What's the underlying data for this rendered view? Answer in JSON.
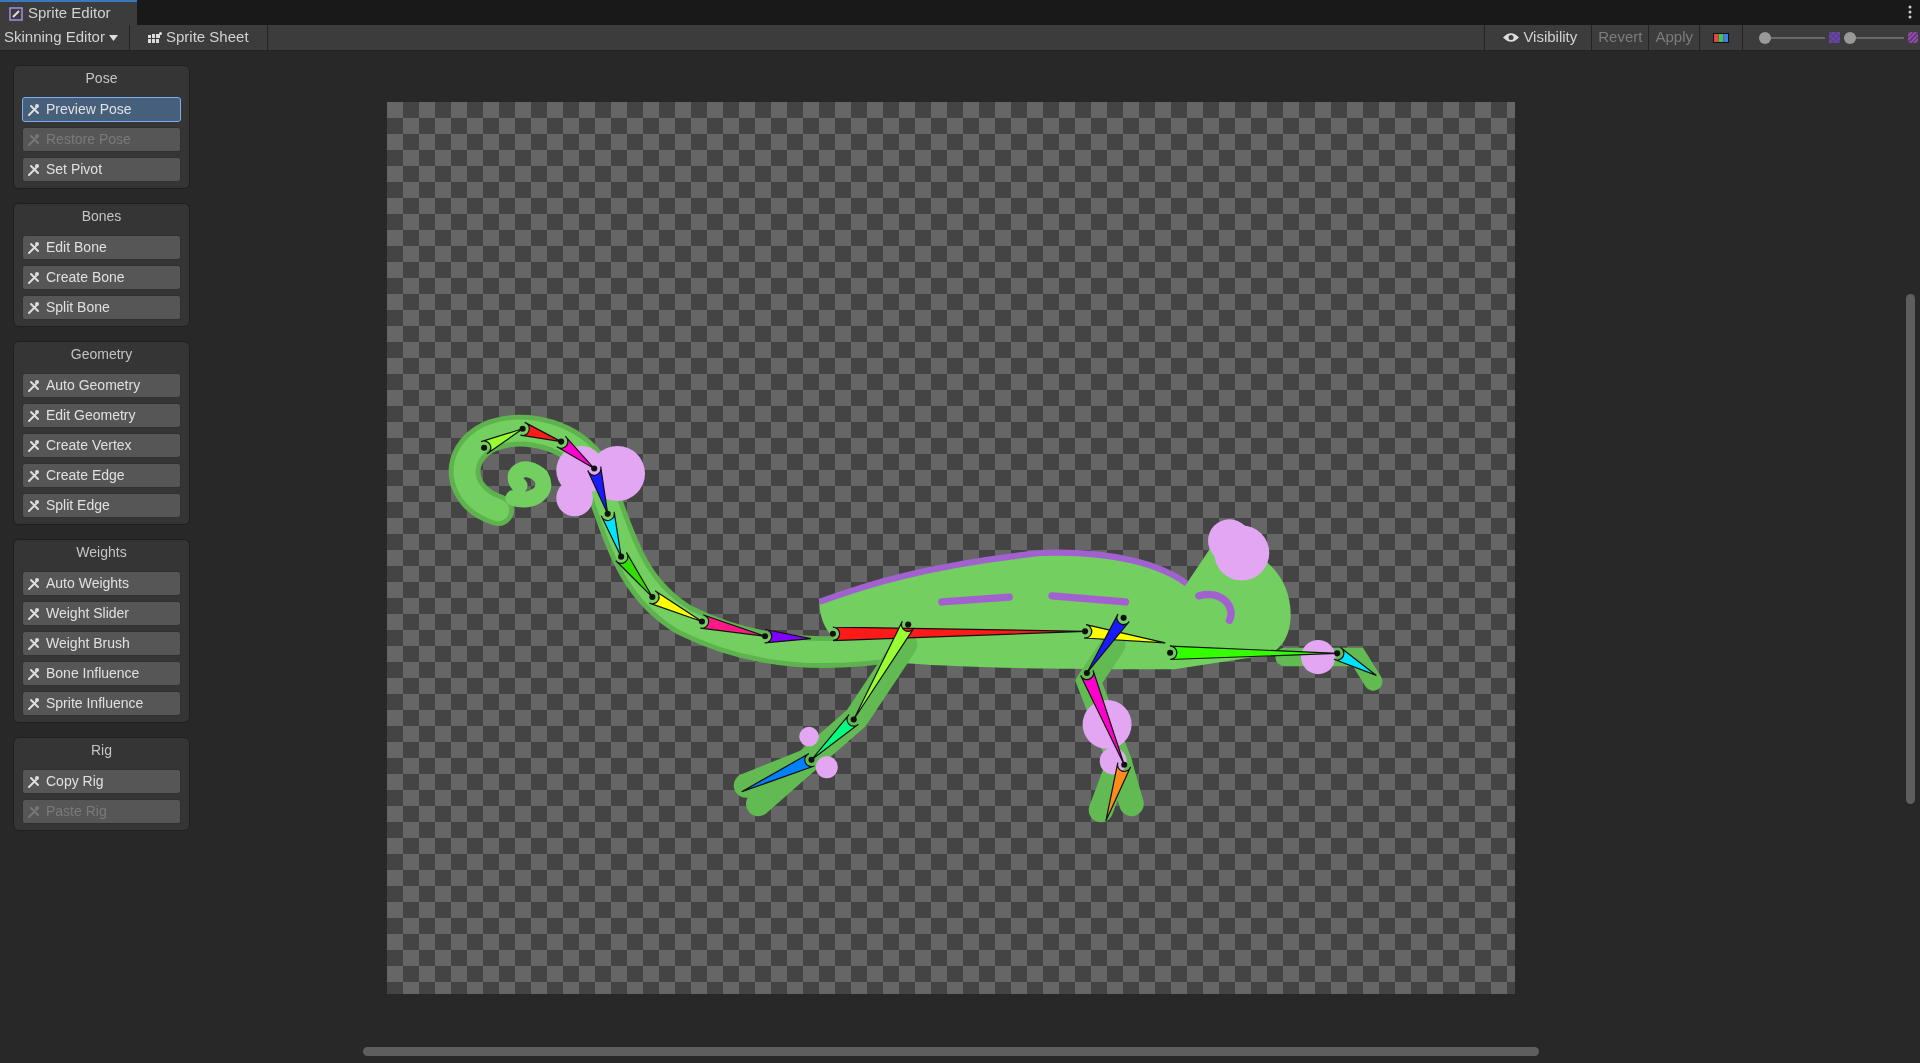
{
  "window": {
    "tab_title": "Sprite Editor"
  },
  "toolbar": {
    "mode_dropdown": "Skinning Editor",
    "sprite_sheet": "Sprite Sheet",
    "visibility": "Visibility",
    "revert": {
      "label": "Revert",
      "disabled": true
    },
    "apply": {
      "label": "Apply",
      "disabled": true
    },
    "sliders": [
      {
        "level": 0
      },
      {
        "level": 0
      }
    ]
  },
  "tool_groups": [
    {
      "title": "Pose",
      "buttons": [
        {
          "label": "Preview Pose",
          "selected": true,
          "disabled": false
        },
        {
          "label": "Restore Pose",
          "selected": false,
          "disabled": true
        },
        {
          "label": "Set Pivot",
          "selected": false,
          "disabled": false
        }
      ]
    },
    {
      "title": "Bones",
      "buttons": [
        {
          "label": "Edit Bone",
          "selected": false,
          "disabled": false
        },
        {
          "label": "Create Bone",
          "selected": false,
          "disabled": false
        },
        {
          "label": "Split Bone",
          "selected": false,
          "disabled": false
        }
      ]
    },
    {
      "title": "Geometry",
      "buttons": [
        {
          "label": "Auto Geometry",
          "selected": false,
          "disabled": false
        },
        {
          "label": "Edit Geometry",
          "selected": false,
          "disabled": false
        },
        {
          "label": "Create Vertex",
          "selected": false,
          "disabled": false
        },
        {
          "label": "Create Edge",
          "selected": false,
          "disabled": false
        },
        {
          "label": "Split Edge",
          "selected": false,
          "disabled": false
        }
      ]
    },
    {
      "title": "Weights",
      "buttons": [
        {
          "label": "Auto Weights",
          "selected": false,
          "disabled": false
        },
        {
          "label": "Weight Slider",
          "selected": false,
          "disabled": false
        },
        {
          "label": "Weight Brush",
          "selected": false,
          "disabled": false
        },
        {
          "label": "Bone Influence",
          "selected": false,
          "disabled": false
        },
        {
          "label": "Sprite Influence",
          "selected": false,
          "disabled": false
        }
      ]
    },
    {
      "title": "Rig",
      "buttons": [
        {
          "label": "Copy Rig",
          "selected": false,
          "disabled": false
        },
        {
          "label": "Paste Rig",
          "selected": false,
          "disabled": true
        }
      ]
    }
  ]
}
